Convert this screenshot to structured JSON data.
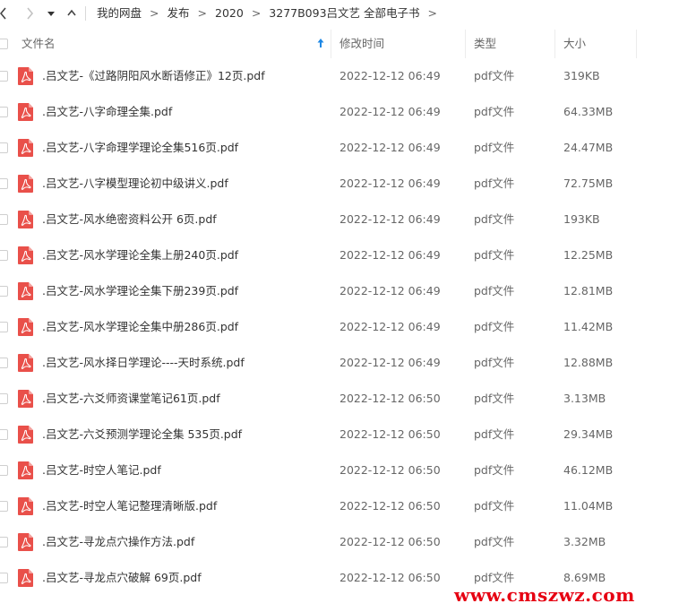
{
  "toolbar": {
    "back_icon": "chevron-left-icon",
    "forward_icon": "chevron-right-icon",
    "dropdown_icon": "caret-down-icon"
  },
  "breadcrumb": {
    "items": [
      "我的网盘",
      "发布",
      "2020",
      "3277B093吕文艺 全部电子书"
    ],
    "separator": ">"
  },
  "table": {
    "columns": [
      "文件名",
      "修改时间",
      "类型",
      "大小"
    ],
    "sort_column": "文件名",
    "sort_direction": "ascending",
    "accent_color": "#1e88e5",
    "pdf_icon_color": "#e9504a",
    "rows": [
      {
        "name": ".吕文艺-《过路阴阳风水断语修正》12页.pdf",
        "modified": "2022-12-12 06:49",
        "type": "pdf文件",
        "size": "319KB"
      },
      {
        "name": ".吕文艺-八字命理全集.pdf",
        "modified": "2022-12-12 06:49",
        "type": "pdf文件",
        "size": "64.33MB"
      },
      {
        "name": ".吕文艺-八字命理学理论全集516页.pdf",
        "modified": "2022-12-12 06:49",
        "type": "pdf文件",
        "size": "24.47MB"
      },
      {
        "name": ".吕文艺-八字模型理论初中级讲义.pdf",
        "modified": "2022-12-12 06:49",
        "type": "pdf文件",
        "size": "72.75MB"
      },
      {
        "name": ".吕文艺-风水绝密资料公开 6页.pdf",
        "modified": "2022-12-12 06:49",
        "type": "pdf文件",
        "size": "193KB"
      },
      {
        "name": ".吕文艺-风水学理论全集上册240页.pdf",
        "modified": "2022-12-12 06:49",
        "type": "pdf文件",
        "size": "12.25MB"
      },
      {
        "name": ".吕文艺-风水学理论全集下册239页.pdf",
        "modified": "2022-12-12 06:49",
        "type": "pdf文件",
        "size": "12.81MB"
      },
      {
        "name": ".吕文艺-风水学理论全集中册286页.pdf",
        "modified": "2022-12-12 06:49",
        "type": "pdf文件",
        "size": "11.42MB"
      },
      {
        "name": ".吕文艺-风水择日学理论----天时系统.pdf",
        "modified": "2022-12-12 06:49",
        "type": "pdf文件",
        "size": "12.88MB"
      },
      {
        "name": ".吕文艺-六爻师资课堂笔记61页.pdf",
        "modified": "2022-12-12 06:50",
        "type": "pdf文件",
        "size": "3.13MB"
      },
      {
        "name": ".吕文艺-六爻预测学理论全集 535页.pdf",
        "modified": "2022-12-12 06:50",
        "type": "pdf文件",
        "size": "29.34MB"
      },
      {
        "name": ".吕文艺-时空人笔记.pdf",
        "modified": "2022-12-12 06:50",
        "type": "pdf文件",
        "size": "46.12MB"
      },
      {
        "name": ".吕文艺-时空人笔记整理清晰版.pdf",
        "modified": "2022-12-12 06:50",
        "type": "pdf文件",
        "size": "11.04MB"
      },
      {
        "name": ".吕文艺-寻龙点穴操作方法.pdf",
        "modified": "2022-12-12 06:50",
        "type": "pdf文件",
        "size": "3.32MB"
      },
      {
        "name": ".吕文艺-寻龙点穴破解 69页.pdf",
        "modified": "2022-12-12 06:50",
        "type": "pdf文件",
        "size": "8.69MB"
      }
    ]
  },
  "watermark": {
    "text": "www.cmszwz.com",
    "color": "#e60012"
  }
}
